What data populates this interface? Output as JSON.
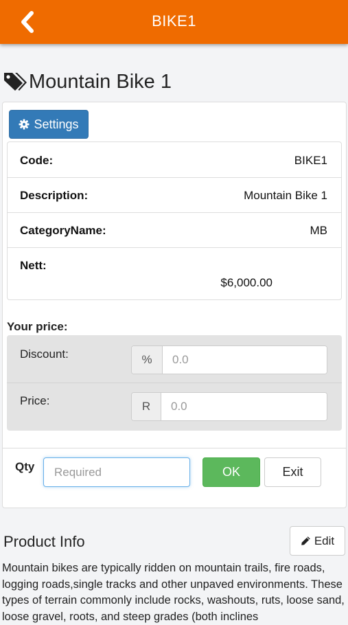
{
  "header": {
    "title": "BIKE1",
    "back_icon": "chevron-left-icon",
    "color": "#ef6b00"
  },
  "product": {
    "icon": "tags-icon",
    "title": "Mountain Bike 1"
  },
  "settings_button": {
    "icon": "gear-icon",
    "label": "Settings"
  },
  "details": [
    {
      "label": "Code:",
      "value": "BIKE1"
    },
    {
      "label": "Description:",
      "value": "Mountain Bike 1"
    },
    {
      "label": "CategoryName:",
      "value": "MB"
    },
    {
      "label": "Nett:",
      "value": "$6,000.00"
    }
  ],
  "pricing": {
    "heading": "Your price:",
    "discount": {
      "label": "Discount:",
      "addon": "%",
      "placeholder": "0.0"
    },
    "price": {
      "label": "Price:",
      "addon": "R",
      "placeholder": "0.0"
    }
  },
  "order": {
    "qty_label": "Qty",
    "qty_placeholder": "Required",
    "ok_label": "OK",
    "exit_label": "Exit"
  },
  "product_info": {
    "title": "Product Info",
    "edit_label": "Edit",
    "edit_icon": "pencil-icon",
    "description": "Mountain bikes are typically ridden on mountain trails, fire roads, logging roads,single tracks and other unpaved environments. These types of terrain commonly include rocks, washouts, ruts, loose sand, loose gravel, roots, and steep grades (both inclines"
  }
}
